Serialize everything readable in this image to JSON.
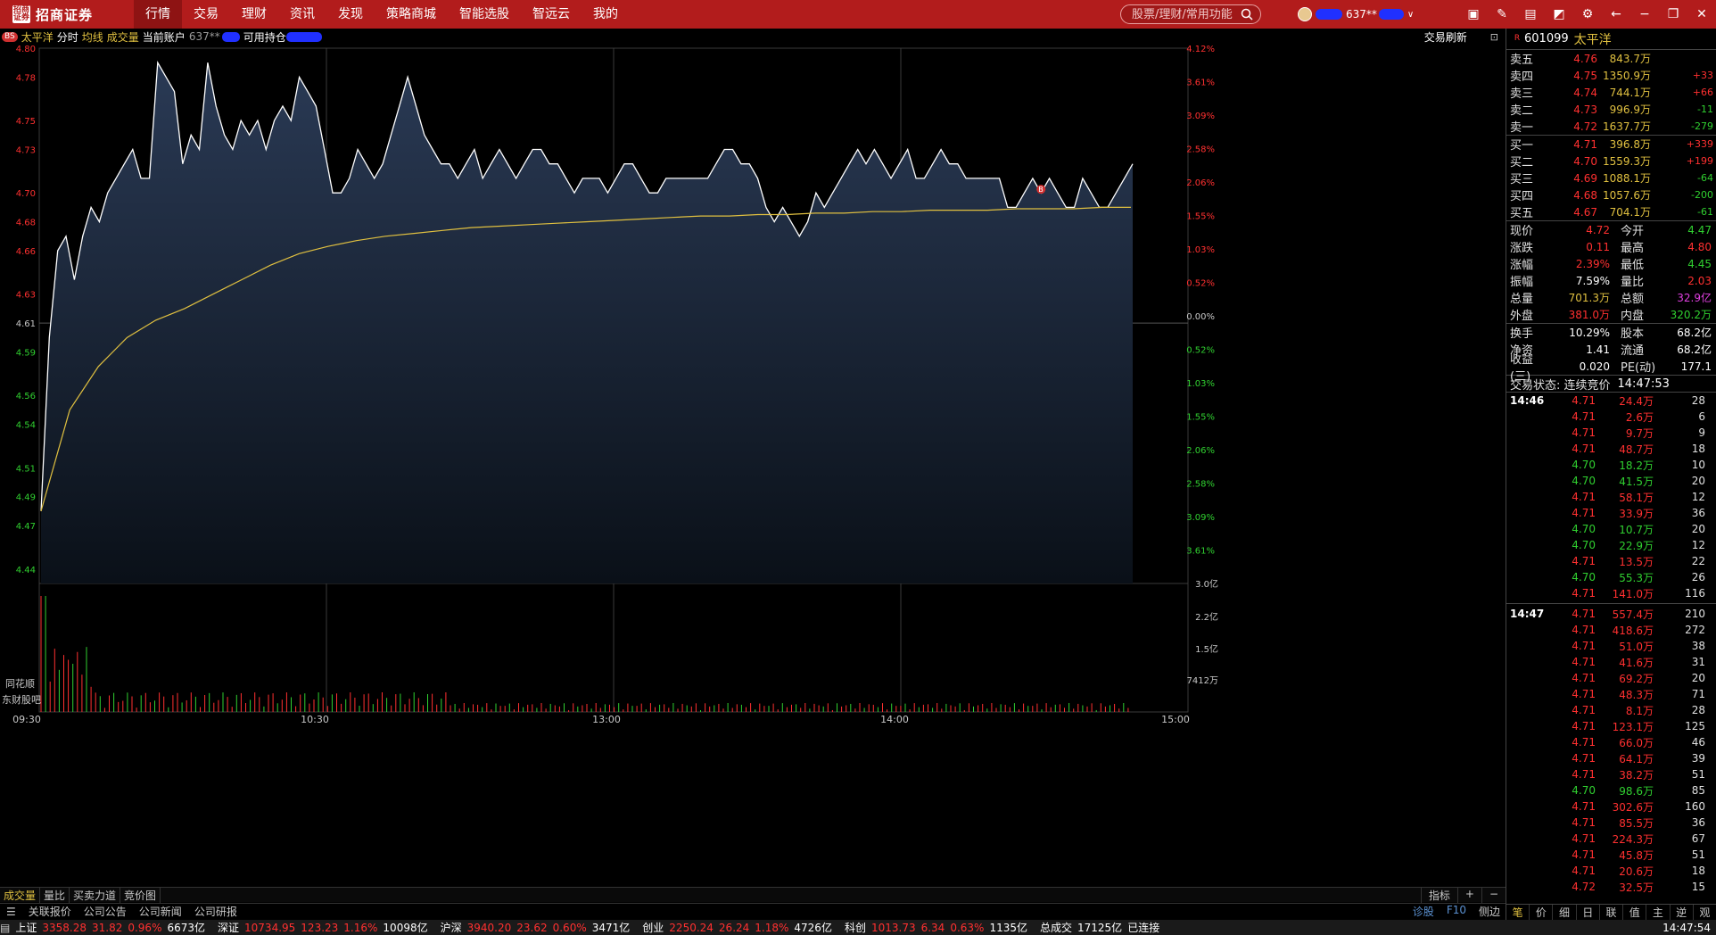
{
  "app": {
    "brand": "招商证券",
    "brand_mark": "招商证券"
  },
  "menu": [
    "行情",
    "交易",
    "理财",
    "资讯",
    "发现",
    "策略商城",
    "智能选股",
    "智远云",
    "我的"
  ],
  "search": {
    "placeholder": "股票/理财/常用功能"
  },
  "user": {
    "account": "637**"
  },
  "subbar": {
    "bs": "BS",
    "stock": "太平洋",
    "labels": [
      "分时",
      "均线",
      "成交量",
      "当前账户",
      "637**",
      "可用持仓"
    ],
    "refresh": "交易刷新"
  },
  "chart_data": {
    "type": "line",
    "title": "太平洋 分时",
    "x": [
      "09:30",
      "10:30",
      "13:00",
      "14:00",
      "15:00"
    ],
    "price_ticks": [
      "4.80",
      "4.78",
      "4.75",
      "4.73",
      "4.70",
      "4.68",
      "4.66",
      "4.63",
      "4.61",
      "4.59",
      "4.56",
      "4.54",
      "4.51",
      "4.49",
      "4.47",
      "4.44"
    ],
    "pct_ticks_up": [
      "4.12%",
      "3.61%",
      "3.09%",
      "2.58%",
      "2.06%",
      "1.55%",
      "1.03%",
      "0.52%",
      "0.00%"
    ],
    "pct_ticks_down": [
      "0.52%",
      "1.03%",
      "1.55%",
      "2.06%",
      "2.58%",
      "3.09%",
      "3.61%"
    ],
    "vol_ticks": [
      "3.0亿",
      "2.2亿",
      "1.5亿",
      "7412万"
    ],
    "prev_close": 4.61,
    "ylim": [
      4.43,
      4.8
    ],
    "series": [
      {
        "name": "价格",
        "values": [
          4.48,
          4.6,
          4.66,
          4.67,
          4.64,
          4.67,
          4.69,
          4.68,
          4.7,
          4.71,
          4.72,
          4.73,
          4.71,
          4.71,
          4.79,
          4.78,
          4.77,
          4.72,
          4.74,
          4.73,
          4.79,
          4.76,
          4.74,
          4.73,
          4.75,
          4.74,
          4.75,
          4.73,
          4.75,
          4.76,
          4.75,
          4.78,
          4.77,
          4.76,
          4.73,
          4.7,
          4.7,
          4.71,
          4.73,
          4.72,
          4.71,
          4.72,
          4.74,
          4.76,
          4.78,
          4.76,
          4.74,
          4.73,
          4.72,
          4.72,
          4.71,
          4.72,
          4.73,
          4.71,
          4.72,
          4.73,
          4.72,
          4.71,
          4.72,
          4.73,
          4.73,
          4.72,
          4.72,
          4.71,
          4.7,
          4.71,
          4.71,
          4.71,
          4.7,
          4.71,
          4.72,
          4.72,
          4.71,
          4.7,
          4.7,
          4.71,
          4.71,
          4.71,
          4.71,
          4.71,
          4.71,
          4.72,
          4.73,
          4.73,
          4.72,
          4.72,
          4.71,
          4.69,
          4.68,
          4.69,
          4.68,
          4.67,
          4.68,
          4.7,
          4.69,
          4.7,
          4.71,
          4.72,
          4.73,
          4.72,
          4.73,
          4.72,
          4.71,
          4.72,
          4.73,
          4.71,
          4.71,
          4.72,
          4.73,
          4.72,
          4.72,
          4.71,
          4.71,
          4.71,
          4.71,
          4.71,
          4.69,
          4.69,
          4.7,
          4.71,
          4.7,
          4.71,
          4.7,
          4.69,
          4.69,
          4.71,
          4.7,
          4.69,
          4.69,
          4.7,
          4.71,
          4.72
        ]
      },
      {
        "name": "均价",
        "values": [
          4.48,
          4.55,
          4.58,
          4.6,
          4.612,
          4.62,
          4.63,
          4.64,
          4.65,
          4.658,
          4.663,
          4.667,
          4.67,
          4.672,
          4.674,
          4.676,
          4.677,
          4.678,
          4.679,
          4.68,
          4.681,
          4.682,
          4.683,
          4.684,
          4.684,
          4.685,
          4.685,
          4.686,
          4.686,
          4.687,
          4.687,
          4.688,
          4.688,
          4.688,
          4.689,
          4.689,
          4.689,
          4.69,
          4.69
        ]
      }
    ]
  },
  "bottom_tabs": [
    "成交量",
    "量比",
    "买卖力道",
    "竞价图"
  ],
  "bottom_right": [
    "指标",
    "+",
    "−"
  ],
  "info_tabs": [
    "同花顺",
    "东财股吧"
  ],
  "info_tabs2": [
    "关联报价",
    "公司公告",
    "公司新闻",
    "公司研报"
  ],
  "info_right": [
    "诊股",
    "F10",
    "侧边"
  ],
  "rp": {
    "rz": "R",
    "code": "601099",
    "name": "太平洋",
    "asks": [
      {
        "label": "卖五",
        "price": "4.76",
        "vol": "843.7万",
        "chg": ""
      },
      {
        "label": "卖四",
        "price": "4.75",
        "vol": "1350.9万",
        "chg": "+33"
      },
      {
        "label": "卖三",
        "price": "4.74",
        "vol": "744.1万",
        "chg": "+66"
      },
      {
        "label": "卖二",
        "price": "4.73",
        "vol": "996.9万",
        "chg": "-11"
      },
      {
        "label": "卖一",
        "price": "4.72",
        "vol": "1637.7万",
        "chg": "-279"
      }
    ],
    "bids": [
      {
        "label": "买一",
        "price": "4.71",
        "vol": "396.8万",
        "chg": "+339"
      },
      {
        "label": "买二",
        "price": "4.70",
        "vol": "1559.3万",
        "chg": "+199"
      },
      {
        "label": "买三",
        "price": "4.69",
        "vol": "1088.1万",
        "chg": "-64"
      },
      {
        "label": "买四",
        "price": "4.68",
        "vol": "1057.6万",
        "chg": "-200"
      },
      {
        "label": "买五",
        "price": "4.67",
        "vol": "704.1万",
        "chg": "-61"
      }
    ],
    "quote": [
      [
        "现价",
        "4.72",
        "今开",
        "4.47"
      ],
      [
        "涨跌",
        "0.11",
        "最高",
        "4.80"
      ],
      [
        "涨幅",
        "2.39%",
        "最低",
        "4.45"
      ],
      [
        "振幅",
        "7.59%",
        "量比",
        "2.03"
      ],
      [
        "总量",
        "701.3万",
        "总额",
        "32.9亿"
      ],
      [
        "外盘",
        "381.0万",
        "内盘",
        "320.2万"
      ]
    ],
    "quote2": [
      [
        "换手",
        "10.29%",
        "股本",
        "68.2亿"
      ],
      [
        "净资",
        "1.41",
        "流通",
        "68.2亿"
      ],
      [
        "收益(三)",
        "0.020",
        "PE(动)",
        "177.1"
      ]
    ],
    "trade_state": "交易状态: 连续竞价",
    "trade_time": "14:47:53",
    "ticks1_time": "14:46",
    "ticks1": [
      [
        "4.71",
        "24.4万",
        "28"
      ],
      [
        "4.71",
        "2.6万",
        "6"
      ],
      [
        "4.71",
        "9.7万",
        "9"
      ],
      [
        "4.71",
        "48.7万",
        "18"
      ],
      [
        "4.70",
        "18.2万",
        "10"
      ],
      [
        "4.70",
        "41.5万",
        "20"
      ],
      [
        "4.71",
        "58.1万",
        "12"
      ],
      [
        "4.71",
        "33.9万",
        "36"
      ],
      [
        "4.70",
        "10.7万",
        "20"
      ],
      [
        "4.70",
        "22.9万",
        "12"
      ],
      [
        "4.71",
        "13.5万",
        "22"
      ],
      [
        "4.70",
        "55.3万",
        "26"
      ],
      [
        "4.71",
        "141.0万",
        "116"
      ]
    ],
    "ticks2_time": "14:47",
    "ticks2": [
      [
        "4.71",
        "557.4万",
        "210"
      ],
      [
        "4.71",
        "418.6万",
        "272"
      ],
      [
        "4.71",
        "51.0万",
        "38"
      ],
      [
        "4.71",
        "41.6万",
        "31"
      ],
      [
        "4.71",
        "69.2万",
        "20"
      ],
      [
        "4.71",
        "48.3万",
        "71"
      ],
      [
        "4.71",
        "8.1万",
        "28"
      ],
      [
        "4.71",
        "123.1万",
        "125"
      ],
      [
        "4.71",
        "66.0万",
        "46"
      ],
      [
        "4.71",
        "64.1万",
        "39"
      ],
      [
        "4.71",
        "38.2万",
        "51"
      ],
      [
        "4.70",
        "98.6万",
        "85"
      ],
      [
        "4.71",
        "302.6万",
        "160"
      ],
      [
        "4.71",
        "85.5万",
        "36"
      ],
      [
        "4.71",
        "224.3万",
        "67"
      ],
      [
        "4.71",
        "45.8万",
        "51"
      ],
      [
        "4.71",
        "20.6万",
        "18"
      ],
      [
        "4.72",
        "32.5万",
        "15"
      ]
    ],
    "foot": [
      "笔",
      "价",
      "细",
      "日",
      "联",
      "值",
      "主",
      "逆",
      "观"
    ]
  },
  "status": [
    {
      "n": "上证",
      "v": "3358.28",
      "c": "31.82",
      "p": "0.96%",
      "a": "6673亿"
    },
    {
      "n": "深证",
      "v": "10734.95",
      "c": "123.23",
      "p": "1.16%",
      "a": "10098亿"
    },
    {
      "n": "沪深",
      "v": "3940.20",
      "c": "23.62",
      "p": "0.60%",
      "a": "3471亿"
    },
    {
      "n": "创业",
      "v": "2250.24",
      "c": "26.24",
      "p": "1.18%",
      "a": "4726亿"
    },
    {
      "n": "科创",
      "v": "1013.73",
      "c": "6.34",
      "p": "0.63%",
      "a": "1135亿"
    }
  ],
  "status_total_label": "总成交",
  "status_total": "17125亿",
  "status_conn": "已连接",
  "status_time": "14:47:54"
}
